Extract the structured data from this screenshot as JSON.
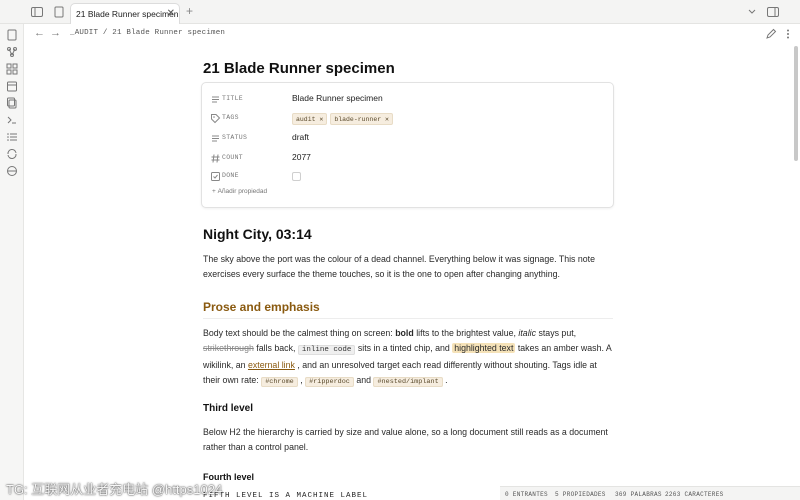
{
  "tab": {
    "title": "21 Blade Runner specimen",
    "close": "✕"
  },
  "new_tab": "+",
  "nav": {
    "back": "←",
    "forward": "→",
    "breadcrumb": "_AUDIT / 21 Blade Runner specimen"
  },
  "doc": {
    "title": "21 Blade Runner specimen",
    "properties": [
      {
        "key": "TITLE",
        "value": "Blade Runner specimen",
        "icon": "list-icon"
      },
      {
        "key": "TAGS",
        "tags": [
          "audit ✕",
          "blade-runner ✕"
        ],
        "icon": "tag-icon"
      },
      {
        "key": "STATUS",
        "value": "draft",
        "icon": "list-icon"
      },
      {
        "key": "COUNT",
        "value": "2077",
        "icon": "hash-icon"
      },
      {
        "key": "DONE",
        "checked": false,
        "icon": "checkbox-icon"
      }
    ],
    "add_property": "Añadir propiedad",
    "h1": "Night City, 03:14",
    "intro": "The sky above the port was the colour of a dead channel. Everything below it was signage. This note exercises every surface the theme touches, so it is the one to open after changing anything.",
    "h2": "Prose and emphasis",
    "para": {
      "t1": "Body text should be the calmest thing on screen: ",
      "bold": "bold",
      "t2": " lifts to the brightest value, ",
      "italic": "italic",
      "t3": " stays put,",
      "strike": "strikethrough",
      "t4": " falls back, ",
      "code": "inline code",
      "t5": " sits in a tinted chip, and ",
      "highlight": "highlighted text",
      "t6": " takes an amber wash. A wikilink, an ",
      "link": "external link",
      "t7": " , and an unresolved target each read differently without shouting. Tags idle at their own rate: ",
      "tag1": "#chrome",
      "t8": " , ",
      "tag2": "#ripperdoc",
      "t9": " and ",
      "tag3": "#nested/implant",
      "t10": " ."
    },
    "h3": "Third level",
    "h3_para": "Below H2 the hierarchy is carried by size and value alone, so a long document still reads as a document rather than a control panel.",
    "h4": "Fourth level",
    "h5": "FIFTH LEVEL IS A MACHINE LABEL"
  },
  "status": {
    "links": "0 ENTRANTES",
    "props": "5 PROPIEDADES",
    "words": "369 PALABRAS",
    "chars": "2263 CARACTERES"
  },
  "watermark": "TG: 互联网从业者充电站 @https1024",
  "colors": {
    "accent": "#8a5a10",
    "highlight": "#f5e2b8",
    "chip": "#f6eddf"
  }
}
